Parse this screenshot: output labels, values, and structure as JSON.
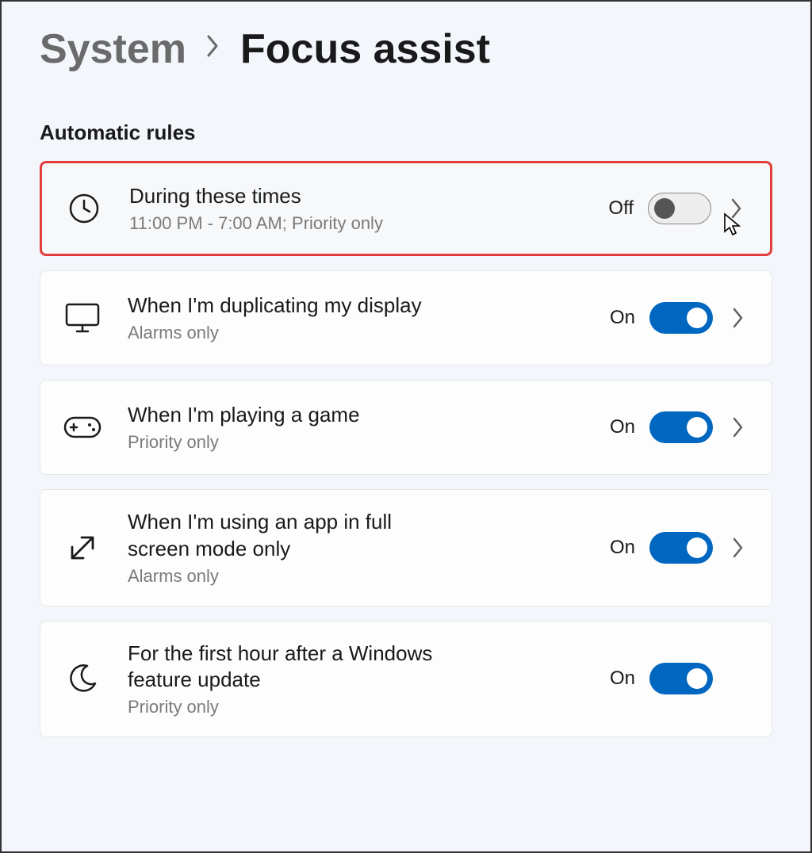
{
  "breadcrumb": {
    "parent": "System",
    "current": "Focus assist"
  },
  "section": {
    "title": "Automatic rules"
  },
  "rules": [
    {
      "id": "during-times",
      "title": "During these times",
      "subtitle": "11:00 PM - 7:00 AM; Priority only",
      "icon": "clock-icon",
      "state_label": "Off",
      "toggle": "off",
      "has_chevron": true,
      "highlighted": true,
      "cursor_on_toggle": true
    },
    {
      "id": "duplicating-display",
      "title": "When I'm duplicating my display",
      "subtitle": "Alarms only",
      "icon": "monitor-icon",
      "state_label": "On",
      "toggle": "on",
      "has_chevron": true,
      "highlighted": false
    },
    {
      "id": "playing-game",
      "title": "When I'm playing a game",
      "subtitle": "Priority only",
      "icon": "gamepad-icon",
      "state_label": "On",
      "toggle": "on",
      "has_chevron": true,
      "highlighted": false
    },
    {
      "id": "fullscreen-app",
      "title": "When I'm using an app in full screen mode only",
      "subtitle": "Alarms only",
      "icon": "expand-icon",
      "state_label": "On",
      "toggle": "on",
      "has_chevron": true,
      "highlighted": false
    },
    {
      "id": "after-update",
      "title": "For the first hour after a Windows feature update",
      "subtitle": "Priority only",
      "icon": "moon-icon",
      "state_label": "On",
      "toggle": "on",
      "has_chevron": false,
      "highlighted": false
    }
  ],
  "colors": {
    "accent": "#0067c0",
    "highlight_border": "#e33e3c"
  }
}
